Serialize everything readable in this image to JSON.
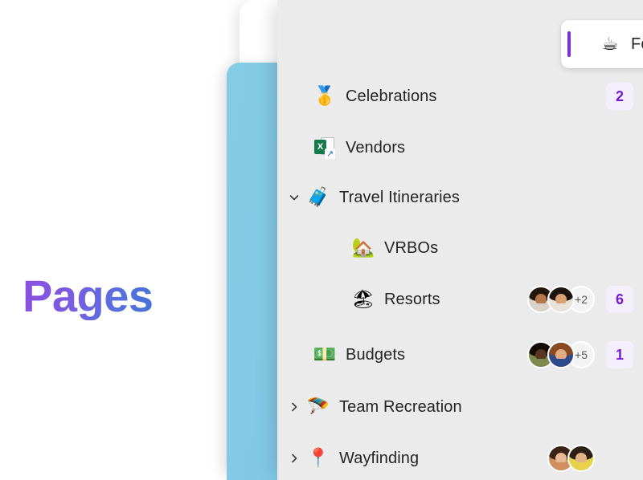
{
  "hero": {
    "title": "Pages"
  },
  "theme": {
    "accent_purple": "#7B2FD6",
    "badge_bg": "#f4effd",
    "badge_text": "#7719d4",
    "sidebar_bg": "#ebebeb",
    "panel_blue": "#7FC8E6",
    "title_gradient_from": "#8B4FE0",
    "title_gradient_to": "#4472D8"
  },
  "sidebar": {
    "items": [
      {
        "label": "Fourth Coffee Project",
        "emoji": "☕",
        "emoji_name": "coffee-cup-icon",
        "indent": 0,
        "expander": "none",
        "selected": true,
        "badge": "",
        "avatars": [
          {
            "skin": "#f0c8b0",
            "hair": "#2b2b2b",
            "shirt": "#e8e3de"
          },
          {
            "skin": "#eec4a3",
            "hair": "#4a3526",
            "shirt": "#f2efe9"
          },
          {
            "skin": "#edc3a6",
            "hair": "#7d1b2e",
            "shirt": "#b0243c"
          }
        ],
        "overflow": ""
      },
      {
        "label": "Celebrations",
        "emoji": "🥇",
        "emoji_name": "medal-icon",
        "indent": 1,
        "expander": "none",
        "selected": false,
        "badge": "2",
        "avatars": [],
        "overflow": ""
      },
      {
        "label": "Vendors",
        "emoji": "xls",
        "emoji_name": "excel-file-icon",
        "indent": 1,
        "expander": "none",
        "selected": false,
        "badge": "",
        "avatars": [],
        "overflow": ""
      },
      {
        "label": "Travel Itineraries",
        "emoji": "🧳",
        "emoji_name": "luggage-icon",
        "indent": 0,
        "expander": "expanded",
        "selected": false,
        "badge": "",
        "avatars": [],
        "overflow": ""
      },
      {
        "label": "VRBOs",
        "emoji": "🏡",
        "emoji_name": "house-with-garden-icon",
        "indent": 2,
        "expander": "none",
        "selected": false,
        "badge": "",
        "avatars": [],
        "overflow": ""
      },
      {
        "label": "Resorts",
        "emoji": "🏖",
        "emoji_name": "beach-umbrella-icon",
        "indent": 2,
        "expander": "none",
        "selected": false,
        "badge": "6",
        "avatars": [
          {
            "skin": "#b5774a",
            "hair": "#24150d",
            "shirt": "#d8d2c8"
          },
          {
            "skin": "#d9a173",
            "hair": "#1d1410",
            "shirt": "#e9e2d8"
          }
        ],
        "overflow": "+2"
      },
      {
        "label": "Budgets",
        "emoji": "💵",
        "emoji_name": "money-icon",
        "indent": 1,
        "expander": "none",
        "selected": false,
        "badge": "1",
        "avatars": [
          {
            "skin": "#5a3622",
            "hair": "#140c06",
            "shirt": "#7c8a4e"
          },
          {
            "skin": "#e0ab84",
            "hair": "#8a4a20",
            "shirt": "#2f4a8c"
          }
        ],
        "overflow": "+5"
      },
      {
        "label": "Team Recreation",
        "emoji": "🪂",
        "emoji_name": "parachute-balloons-icon",
        "indent": 0,
        "expander": "collapsed",
        "selected": false,
        "badge": "",
        "avatars": [],
        "overflow": ""
      },
      {
        "label": "Wayfinding",
        "emoji": "📍",
        "emoji_name": "pushpin-icon",
        "indent": 0,
        "expander": "collapsed",
        "selected": false,
        "badge": "",
        "avatars": [
          {
            "skin": "#e8b894",
            "hair": "#3a2418",
            "shirt": "#cf8f5e"
          },
          {
            "skin": "#e2b287",
            "hair": "#2c2016",
            "shirt": "#e8d24a"
          }
        ],
        "overflow": ""
      }
    ]
  }
}
